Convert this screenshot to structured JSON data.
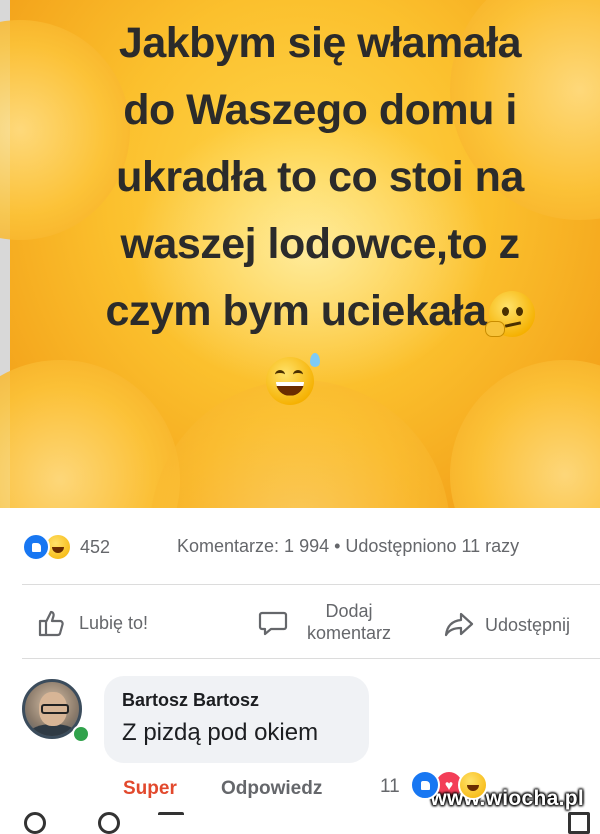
{
  "post": {
    "text_lines": [
      "Jakbym się włamała",
      "do Waszego domu i",
      "ukradła to co stoi na",
      "waszej lodowce,to z",
      "czym bym uciekała"
    ],
    "emojis": [
      "thinking-face",
      "grinning-sweat-face"
    ]
  },
  "stats": {
    "reaction_count": "452",
    "comments_shares": "Komentarze: 1 994 • Udostępniono 11 razy"
  },
  "actions": {
    "like": "Lubię to!",
    "comment": "Dodaj komentarz",
    "share": "Udostępnij"
  },
  "comment": {
    "author": "Bartosz Bartosz",
    "text": "Z pizdą pod okiem",
    "super_label": "Super",
    "reply_label": "Odpowiedz",
    "reaction_count": "11"
  },
  "watermark": "www.wiocha.pl",
  "colors": {
    "like_blue": "#1877f2",
    "super_red": "#e2492d",
    "online_green": "#31a24c",
    "bubble_bg": "#f0f2f5"
  }
}
